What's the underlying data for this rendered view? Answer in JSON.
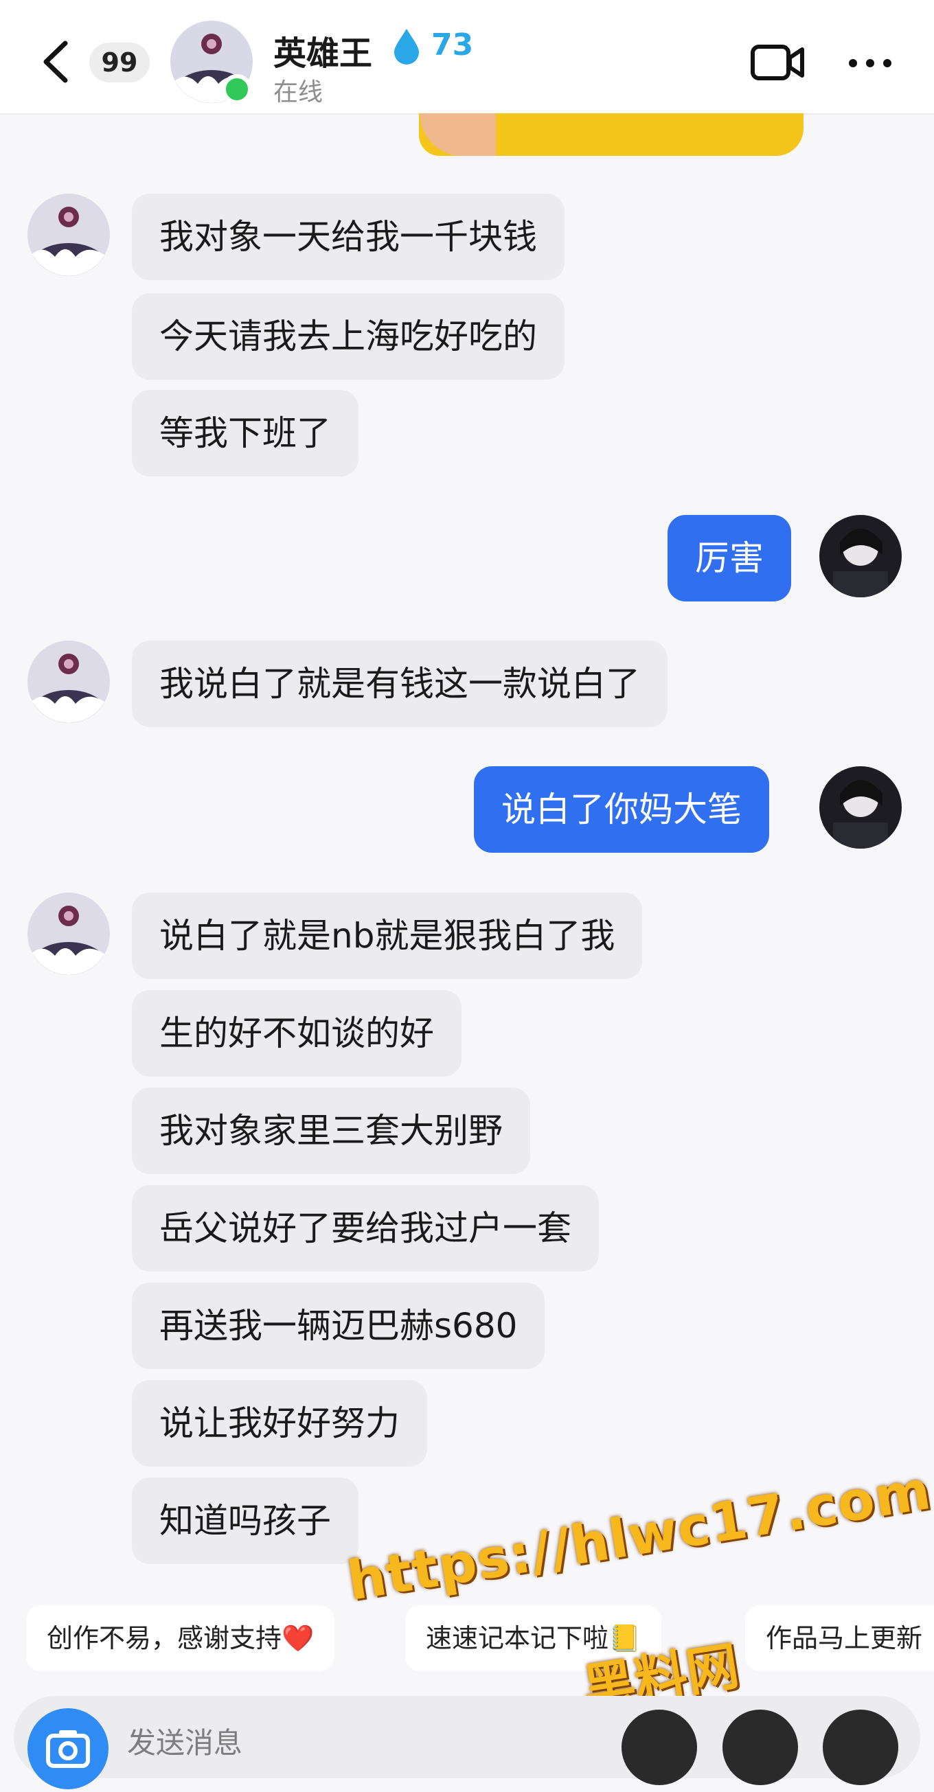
{
  "header": {
    "unread_count": "99",
    "contact_name": "英雄王",
    "intimacy_score": "73",
    "status": "在线"
  },
  "messages": [
    {
      "side": "in",
      "text": "我对象一天给我一千块钱"
    },
    {
      "side": "in",
      "text": "今天请我去上海吃好吃的"
    },
    {
      "side": "in",
      "text": "等我下班了"
    },
    {
      "side": "out",
      "text": "厉害"
    },
    {
      "side": "in",
      "text": "我说白了就是有钱这一款说白了"
    },
    {
      "side": "out",
      "text": "说白了你妈大笔"
    },
    {
      "side": "in",
      "text": "说白了就是nb就是狠我白了我"
    },
    {
      "side": "in",
      "text": "生的好不如谈的好"
    },
    {
      "side": "in",
      "text": "我对象家里三套大别野"
    },
    {
      "side": "in",
      "text": "岳父说好了要给我过户一套"
    },
    {
      "side": "in",
      "text": "再送我一辆迈巴赫s680"
    },
    {
      "side": "in",
      "text": "说让我好好努力"
    },
    {
      "side": "in",
      "text": "知道吗孩子"
    }
  ],
  "quick_replies": [
    {
      "label": "创作不易，感谢支持",
      "emoji": "❤️"
    },
    {
      "label": "速速记本记下啦",
      "emoji": "📒"
    },
    {
      "label": "作品马上更新"
    }
  ],
  "watermark": {
    "url": "https://hlwc17.com",
    "site": "黑料网"
  },
  "input": {
    "placeholder": "发送消息"
  },
  "colors": {
    "outgoing_bubble": "#2f6ff0",
    "incoming_bubble": "#ececef",
    "online_dot": "#31c85a",
    "score": "#29a7e6"
  }
}
